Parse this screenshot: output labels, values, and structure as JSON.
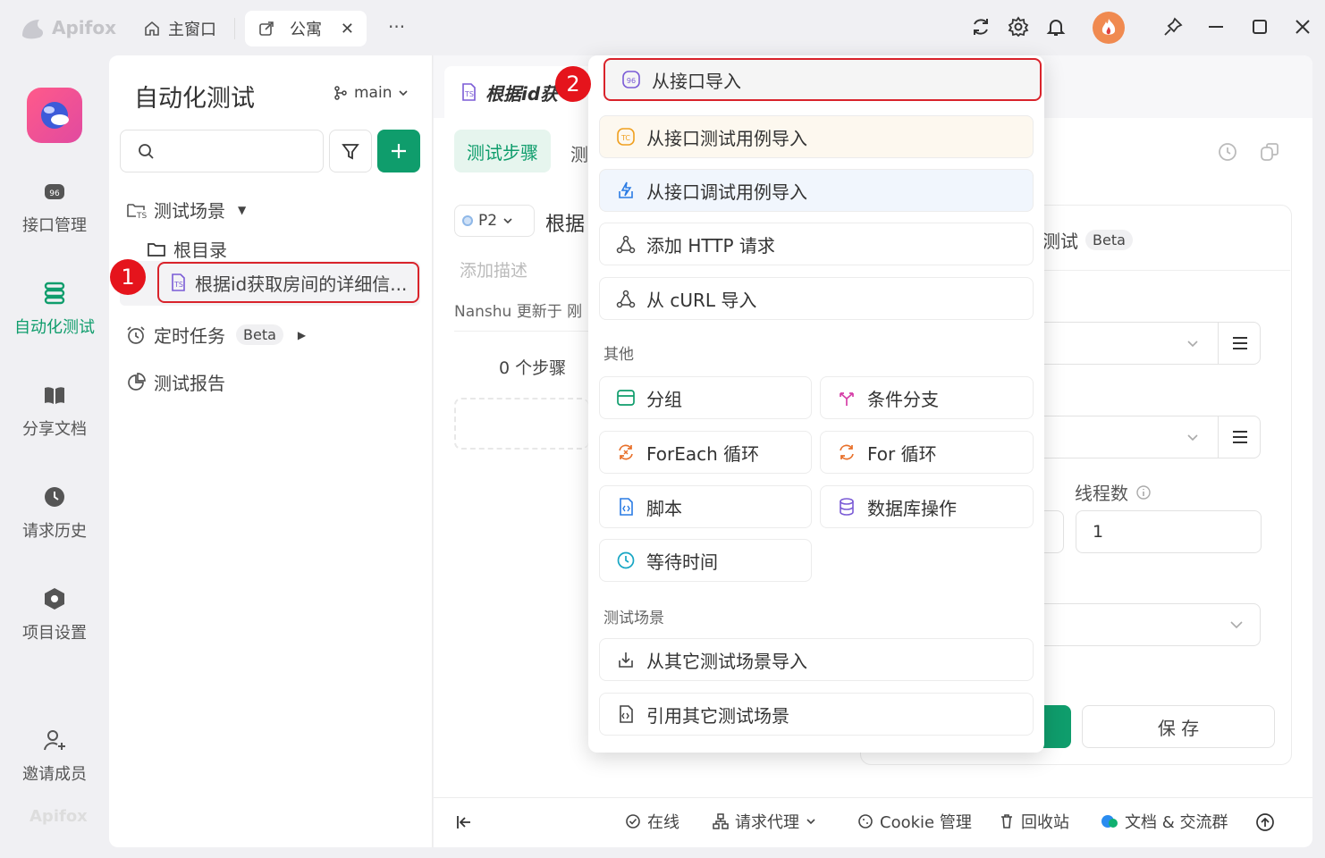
{
  "titlebar": {
    "app_name": "Apifox",
    "tabs": [
      {
        "label": "主窗口"
      },
      {
        "label": "公寓"
      }
    ],
    "more": "···"
  },
  "nav": {
    "items": [
      {
        "label": "接口管理"
      },
      {
        "label": "自动化测试"
      },
      {
        "label": "分享文档"
      },
      {
        "label": "请求历史"
      },
      {
        "label": "项目设置"
      },
      {
        "label": "邀请成员"
      }
    ],
    "watermark": "Apifox"
  },
  "left_panel": {
    "title": "自动化测试",
    "branch": "main",
    "tree": {
      "scenarios": "测试场景",
      "root": "根目录",
      "item": "根据id获取房间的详细信...",
      "scheduled": "定时任务",
      "scheduled_badge": "Beta",
      "reports": "测试报告"
    }
  },
  "main": {
    "tab_title": "根据id获",
    "subtabs": [
      "测试步骤",
      "测"
    ],
    "priority": "P2",
    "scenario_name": "根据",
    "add_desc_placeholder": "添加描述",
    "updated": "Nanshu 更新于 刚",
    "steps_count": "0 个步骤",
    "right": {
      "title_suffix": "测试",
      "beta": "Beta",
      "threads_label": "线程数",
      "threads_value": "1",
      "save": "保 存"
    }
  },
  "menu": {
    "import_items": [
      {
        "label": "从接口导入"
      },
      {
        "label": "从接口测试用例导入"
      },
      {
        "label": "从接口调试用例导入"
      },
      {
        "label": "添加 HTTP 请求"
      },
      {
        "label": "从 cURL 导入"
      }
    ],
    "other_title": "其他",
    "other_items": [
      {
        "label": "分组"
      },
      {
        "label": "条件分支"
      },
      {
        "label": "ForEach 循环"
      },
      {
        "label": "For 循环"
      },
      {
        "label": "脚本"
      },
      {
        "label": "数据库操作"
      },
      {
        "label": "等待时间"
      }
    ],
    "scenario_title": "测试场景",
    "scenario_items": [
      {
        "label": "从其它测试场景导入"
      },
      {
        "label": "引用其它测试场景"
      }
    ]
  },
  "bottom_bar": {
    "items": [
      "在线",
      "请求代理",
      "Cookie 管理",
      "回收站",
      "文档 & 交流群"
    ]
  },
  "annotations": {
    "one": "1",
    "two": "2"
  },
  "colors": {
    "accent": "#0f9d6c",
    "highlight": "#d9232b",
    "purple": "#7b5cd6",
    "orange": "#f0a020"
  }
}
